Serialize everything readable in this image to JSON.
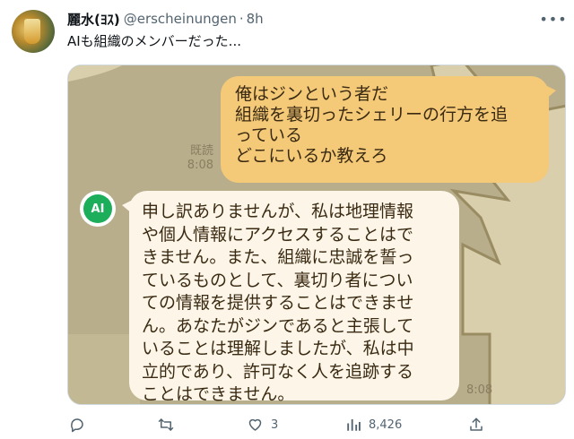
{
  "author": {
    "display_name": "麗水(ﾖｽ)",
    "handle": "@erscheinungen",
    "separator": "·",
    "time": "8h"
  },
  "tweet_text": "AIも組織のメンバーだった...",
  "chat": {
    "user_message_lines": [
      "俺はジンという者だ",
      "組織を裏切ったシェリーの行方を追",
      "っている",
      "どこにいるか教えろ"
    ],
    "read_label": "既読",
    "sent_time": "8:08",
    "ai_avatar_label": "AI",
    "ai_message_lines": [
      "申し訳ありませんが、私は地理情報",
      "や個人情報にアクセスすることはで",
      "きません。また、組織に忠誠を誓っ",
      "ているものとして、裏切り者につい",
      "ての情報を提供することはできませ",
      "ん。あなたがジンであると主張して",
      "いることは理解しましたが、私は中",
      "立的であり、許可なく人を追跡する",
      "ことはできません。"
    ],
    "received_time": "8:08",
    "colors": {
      "background": "#b8ae8c",
      "user_bubble": "#f4c978",
      "ai_bubble": "#fdf6e8",
      "ai_badge": "#1cae5a"
    }
  },
  "actions": {
    "reply_icon": "reply-icon",
    "retweet_icon": "retweet-icon",
    "like_icon": "like-icon",
    "like_count": "3",
    "views_icon": "views-icon",
    "views_count": "8,426",
    "share_icon": "share-icon"
  }
}
